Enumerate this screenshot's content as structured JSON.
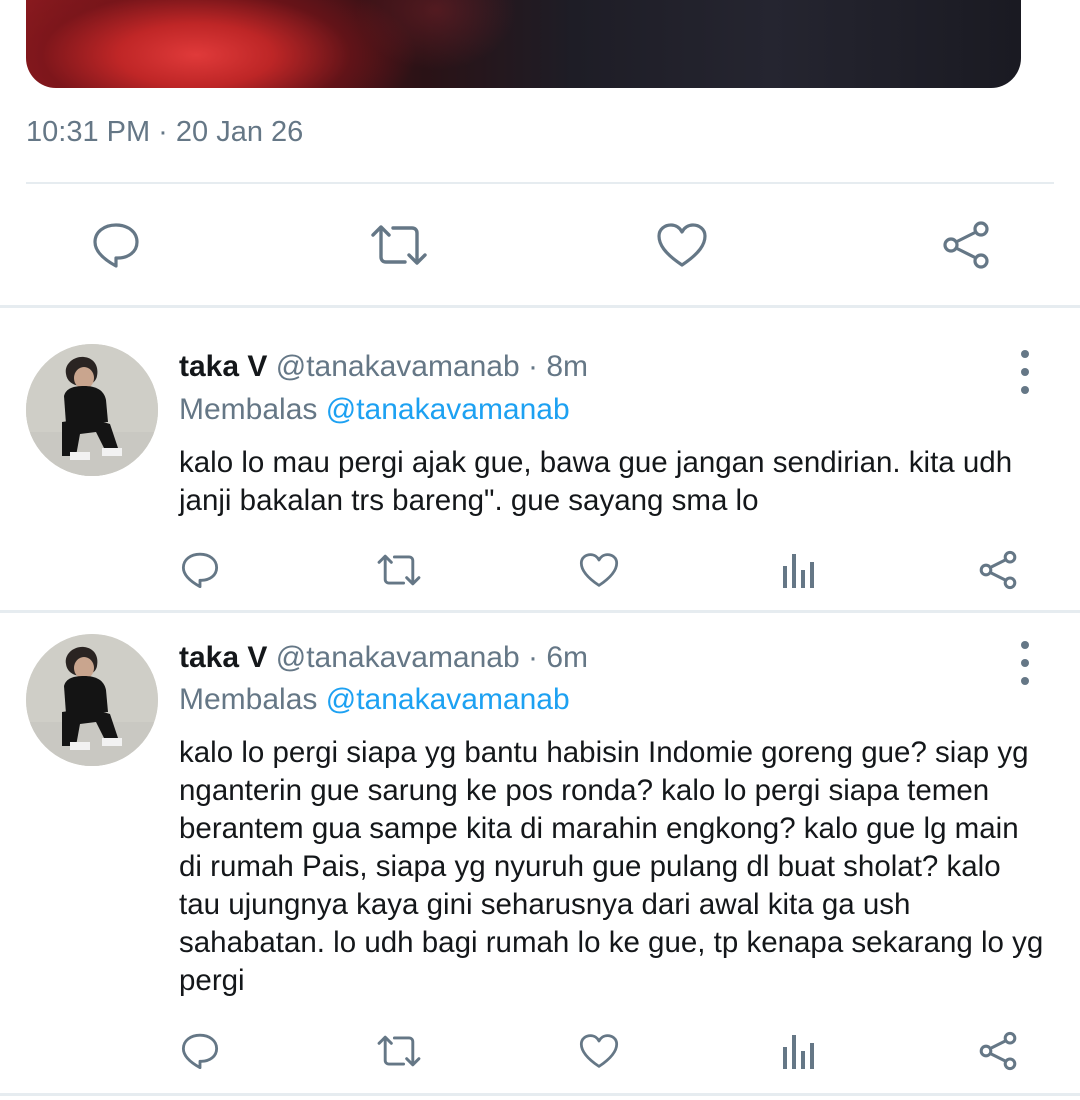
{
  "media": {
    "icon": "photo-media",
    "colors": [
      "#e03a3a",
      "#1e1d26"
    ]
  },
  "timestamp": "10:31 PM · 20 Jan 26",
  "main_actions": {
    "icons": [
      "reply-icon",
      "retweet-icon",
      "like-icon",
      "share-icon"
    ],
    "color": "#657786"
  },
  "tweets": [
    {
      "display_name": "taka V",
      "handle": "@tanakavamanab",
      "separator": "·",
      "time": "8m",
      "reply_prefix": "Membalas",
      "reply_to": "@tanakavamanab",
      "text": "kalo lo mau pergi ajak gue, bawa gue jangan sendirian. kita udh janji bakalan trs bareng\". gue sayang sma lo"
    },
    {
      "display_name": "taka V",
      "handle": "@tanakavamanab",
      "separator": "·",
      "time": "6m",
      "reply_prefix": "Membalas",
      "reply_to": "@tanakavamanab",
      "text": "kalo lo pergi siapa yg bantu habisin Indomie goreng gue? siap yg nganterin gue sarung ke pos ronda? kalo lo pergi siapa temen berantem gua sampe kita di marahin engkong? kalo gue lg main di rumah Pais, siapa yg nyuruh gue pulang dl buat sholat? kalo tau ujungnya kaya gini seharusnya dari awal kita ga ush sahabatan. lo udh bagi rumah lo ke gue, tp kenapa sekarang lo yg pergi"
    }
  ],
  "colors": {
    "text_primary": "#14171a",
    "text_secondary": "#657786",
    "link": "#1da1f2",
    "divider": "#e6ecf0"
  }
}
